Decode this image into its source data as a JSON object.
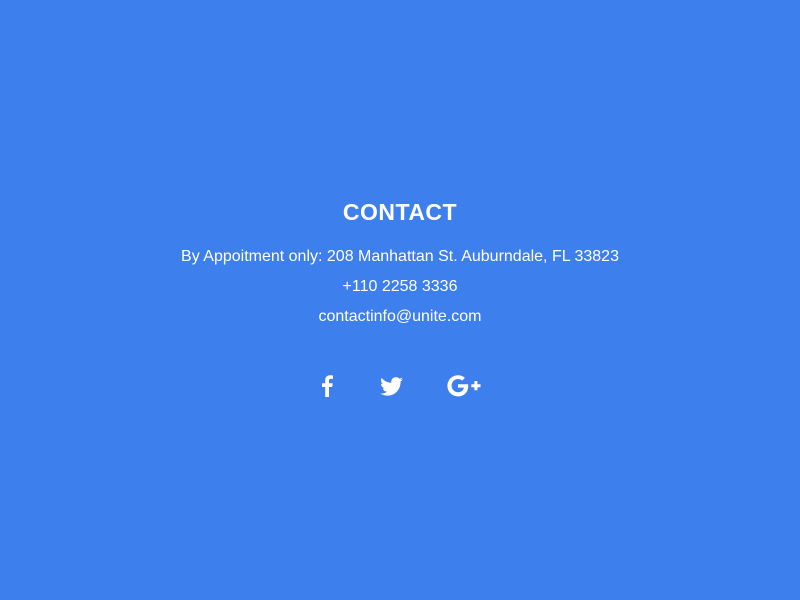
{
  "contact": {
    "title": "CONTACT",
    "address": "By Appoitment only: 208 Manhattan St. Auburndale, FL 33823",
    "phone": "+110 2258 3336",
    "email": "contactinfo@unite.com"
  },
  "social": [
    {
      "name": "facebook",
      "icon": "facebook-icon"
    },
    {
      "name": "twitter",
      "icon": "twitter-icon"
    },
    {
      "name": "google-plus",
      "icon": "google-plus-icon"
    }
  ],
  "colors": {
    "background": "#3e7fee",
    "text": "#ffffff"
  }
}
